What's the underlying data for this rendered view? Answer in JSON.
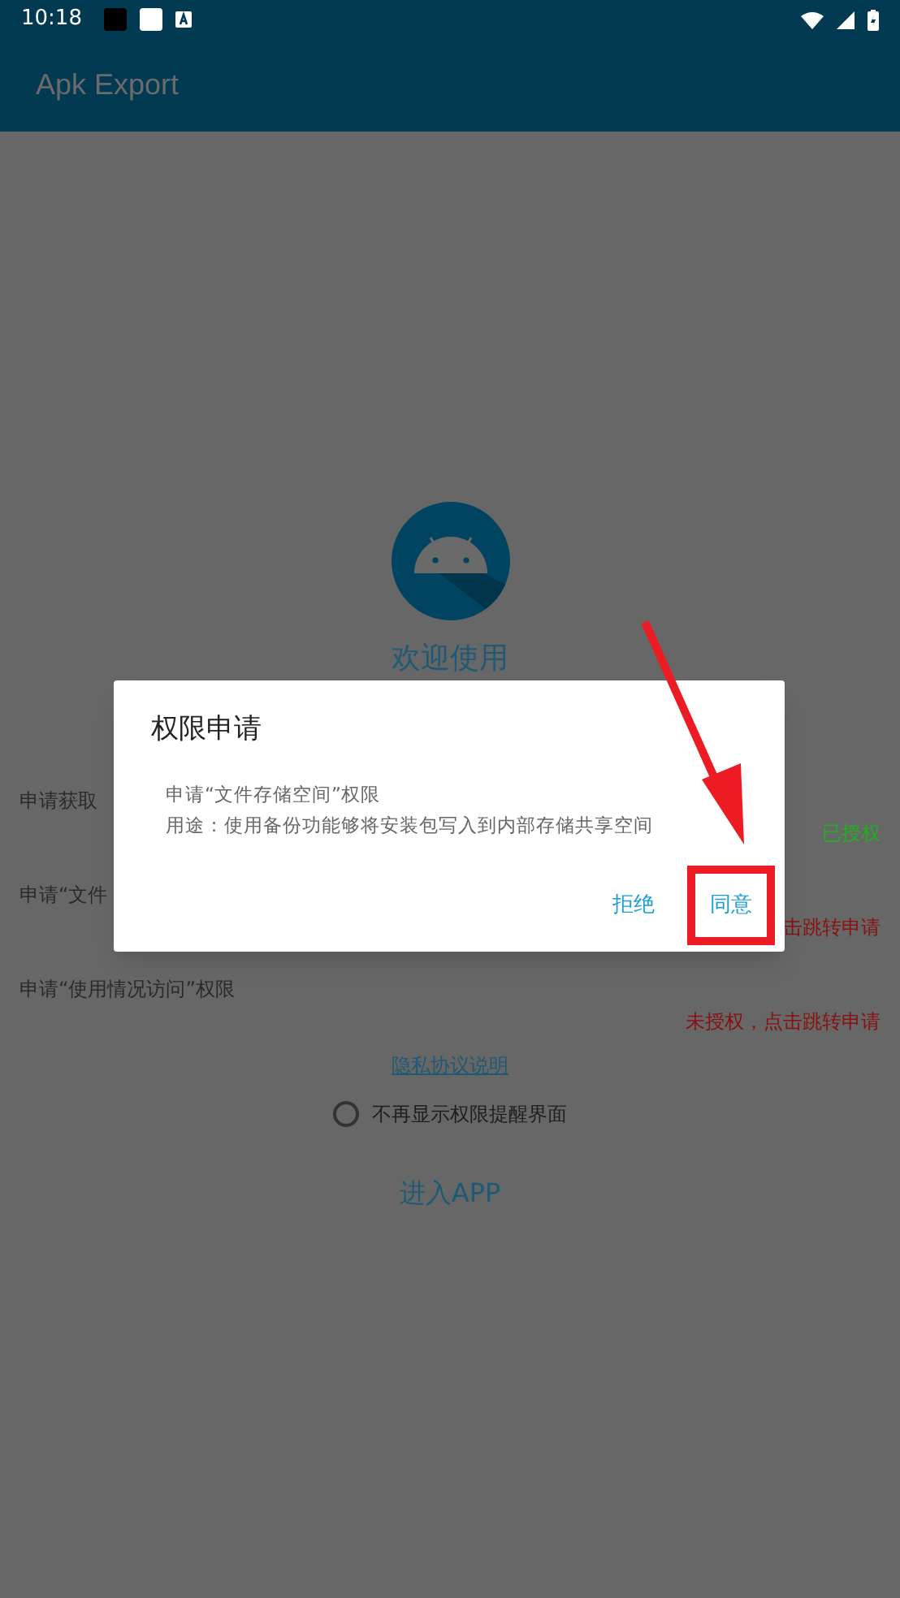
{
  "status_bar": {
    "time": "10:18"
  },
  "app_bar": {
    "title": "Apk Export"
  },
  "welcome": {
    "title": "欢迎使用"
  },
  "permissions": [
    {
      "label": "申请获取",
      "status": "已授权",
      "color": "#22b022"
    },
    {
      "label": "申请“文件",
      "status": "击跳转申请",
      "color": "#8a1010"
    },
    {
      "label": "申请“使用情况访问”权限",
      "status": "未授权，点击跳转申请",
      "color": "#8a1010"
    }
  ],
  "privacy_link": "隐私协议说明",
  "dont_show_again": {
    "label": "不再显示权限提醒界面",
    "checked": false
  },
  "enter_button": "进入APP",
  "dialog": {
    "title": "权限申请",
    "lines": [
      "申请“文件存储空间”权限",
      "用途：使用备份功能够将安装包写入到内部存储共享空间"
    ],
    "buttons": [
      {
        "label": "拒绝",
        "highlighted": false
      },
      {
        "label": "同意",
        "highlighted": true
      }
    ]
  }
}
